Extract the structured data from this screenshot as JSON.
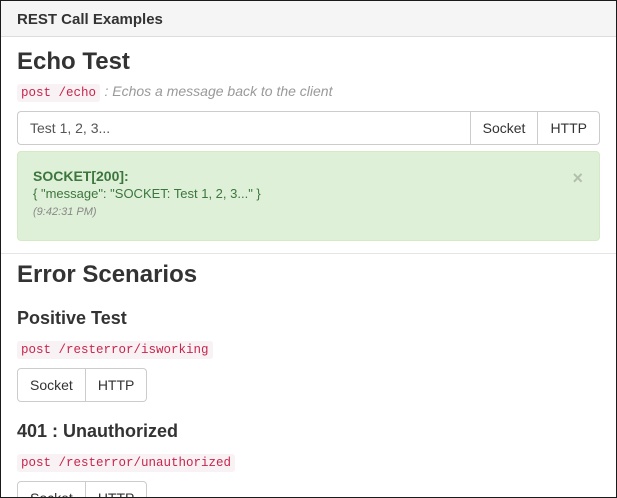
{
  "panel": {
    "title": "REST Call Examples"
  },
  "echo": {
    "heading": "Echo Test",
    "endpoint": "post /echo",
    "description": ": Echos a message back to the client",
    "input_value": "Test 1, 2, 3...",
    "socket_label": "Socket",
    "http_label": "HTTP",
    "alert": {
      "title": "SOCKET[200]:",
      "body": "{ \"message\": \"SOCKET: Test 1, 2, 3...\" }",
      "time": "(9:42:31 PM)",
      "close": "×"
    }
  },
  "errors": {
    "heading": "Error Scenarios",
    "scenarios": [
      {
        "title": "Positive Test",
        "endpoint": "post /resterror/isworking",
        "socket_label": "Socket",
        "http_label": "HTTP"
      },
      {
        "title": "401 : Unauthorized",
        "endpoint": "post /resterror/unauthorized",
        "socket_label": "Socket",
        "http_label": "HTTP"
      }
    ]
  },
  "colors": {
    "alert_success_bg": "#dff0d8",
    "alert_success_text": "#3c763d",
    "code_text": "#c7254e",
    "code_bg": "#f9f2f4"
  }
}
